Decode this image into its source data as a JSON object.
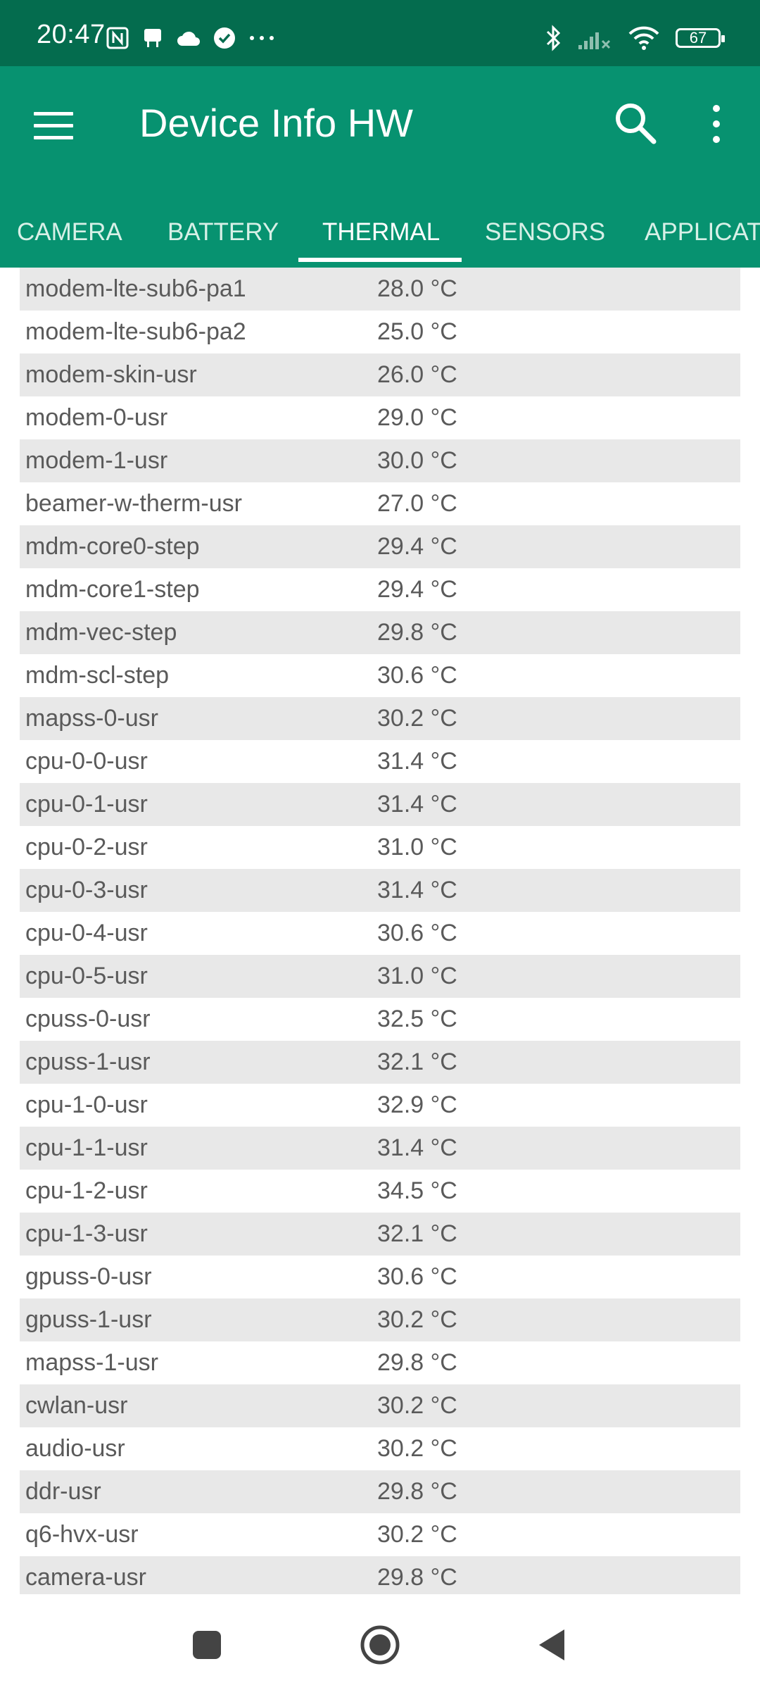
{
  "status_bar": {
    "time": "20:47",
    "battery": "67",
    "left_icons": [
      "nfc-icon",
      "notification-icon",
      "cloud-icon",
      "check-circle-icon",
      "more-dots-icon"
    ],
    "right_icons": [
      "bluetooth-icon",
      "signal-icon",
      "wifi-icon",
      "battery-icon"
    ]
  },
  "app_bar": {
    "title": "Device Info HW",
    "color": "#079270",
    "status_color": "#046c4e"
  },
  "tabs": [
    {
      "label": "CAMERA",
      "active": false
    },
    {
      "label": "BATTERY",
      "active": false
    },
    {
      "label": "THERMAL",
      "active": true
    },
    {
      "label": "SENSORS",
      "active": false
    },
    {
      "label": "APPLICAT",
      "active": false
    }
  ],
  "thermal": [
    {
      "name": "modem-lte-sub6-pa1",
      "value": "28.0 °C"
    },
    {
      "name": "modem-lte-sub6-pa2",
      "value": "25.0 °C"
    },
    {
      "name": "modem-skin-usr",
      "value": "26.0 °C"
    },
    {
      "name": "modem-0-usr",
      "value": "29.0 °C"
    },
    {
      "name": "modem-1-usr",
      "value": "30.0 °C"
    },
    {
      "name": "beamer-w-therm-usr",
      "value": "27.0 °C"
    },
    {
      "name": "mdm-core0-step",
      "value": "29.4 °C"
    },
    {
      "name": "mdm-core1-step",
      "value": "29.4 °C"
    },
    {
      "name": "mdm-vec-step",
      "value": "29.8 °C"
    },
    {
      "name": "mdm-scl-step",
      "value": "30.6 °C"
    },
    {
      "name": "mapss-0-usr",
      "value": "30.2 °C"
    },
    {
      "name": "cpu-0-0-usr",
      "value": "31.4 °C"
    },
    {
      "name": "cpu-0-1-usr",
      "value": "31.4 °C"
    },
    {
      "name": "cpu-0-2-usr",
      "value": "31.0 °C"
    },
    {
      "name": "cpu-0-3-usr",
      "value": "31.4 °C"
    },
    {
      "name": "cpu-0-4-usr",
      "value": "30.6 °C"
    },
    {
      "name": "cpu-0-5-usr",
      "value": "31.0 °C"
    },
    {
      "name": "cpuss-0-usr",
      "value": "32.5 °C"
    },
    {
      "name": "cpuss-1-usr",
      "value": "32.1 °C"
    },
    {
      "name": "cpu-1-0-usr",
      "value": "32.9 °C"
    },
    {
      "name": "cpu-1-1-usr",
      "value": "31.4 °C"
    },
    {
      "name": "cpu-1-2-usr",
      "value": "34.5 °C"
    },
    {
      "name": "cpu-1-3-usr",
      "value": "32.1 °C"
    },
    {
      "name": "gpuss-0-usr",
      "value": "30.6 °C"
    },
    {
      "name": "gpuss-1-usr",
      "value": "30.2 °C"
    },
    {
      "name": "mapss-1-usr",
      "value": "29.8 °C"
    },
    {
      "name": "cwlan-usr",
      "value": "30.2 °C"
    },
    {
      "name": "audio-usr",
      "value": "30.2 °C"
    },
    {
      "name": "ddr-usr",
      "value": "29.8 °C"
    },
    {
      "name": "q6-hvx-usr",
      "value": "30.2 °C"
    },
    {
      "name": "camera-usr",
      "value": "29.8 °C"
    }
  ],
  "nav_bar": {
    "buttons": [
      "recents-icon",
      "home-icon",
      "back-icon"
    ]
  }
}
